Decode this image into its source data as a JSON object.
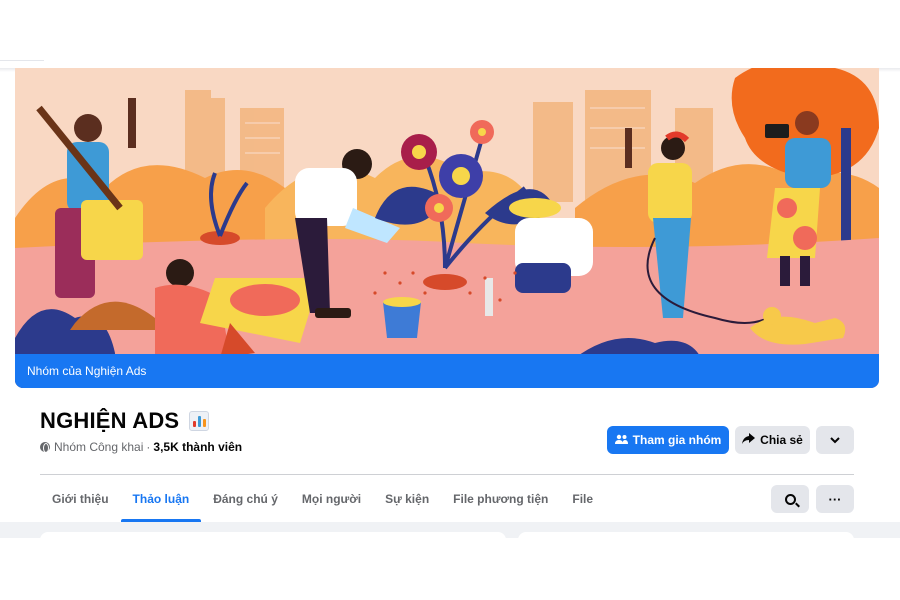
{
  "cover": {
    "caption": "Nhóm của Nghiện Ads",
    "colors": {
      "sky": "#f9d8c3",
      "ground": "#f4a29a",
      "caption_bg": "#1877f2",
      "orange": "#f7941d",
      "navy": "#2c3a8c"
    }
  },
  "group": {
    "name": "NGHIỆN ADS",
    "title_icon": "bar-chart-emoji-icon",
    "privacy": "Nhóm Công khai",
    "separator": "·",
    "members": "3,5K thành viên"
  },
  "actions": {
    "join_label": "Tham gia nhóm",
    "join_icon": "people-icon",
    "share_label": "Chia sẻ",
    "share_icon": "share-arrow-icon",
    "more_icon": "chevron-down-icon"
  },
  "tabs": [
    {
      "label": "Giới thiệu",
      "active": false
    },
    {
      "label": "Thảo luận",
      "active": true
    },
    {
      "label": "Đáng chú ý",
      "active": false
    },
    {
      "label": "Mọi người",
      "active": false
    },
    {
      "label": "Sự kiện",
      "active": false
    },
    {
      "label": "File phương tiện",
      "active": false
    },
    {
      "label": "File",
      "active": false
    }
  ],
  "toolbar": {
    "search_icon": "search-icon",
    "more_glyph": "···"
  },
  "theme": {
    "accent": "#1877f2",
    "button_gray": "#e4e6eb",
    "text": "#050505",
    "muted": "#65676b"
  }
}
